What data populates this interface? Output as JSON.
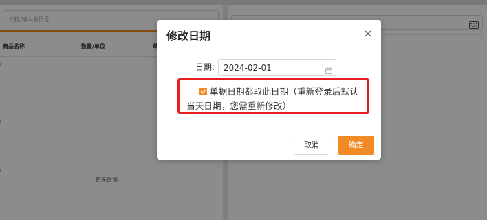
{
  "background": {
    "member_search": {
      "placeholder": "扫描/输入会员号"
    },
    "table": {
      "columns": [
        "商品名称",
        "数量/单位",
        "单"
      ],
      "empty_text": "暂无数据"
    },
    "scan_input": {
      "placeholder": ""
    },
    "accent_color": "#f08a24"
  },
  "dialog": {
    "title": "修改日期",
    "date_label": "日期:",
    "date_value": "2024-02-01",
    "option_text": "单据日期都取此日期（重新登录后默认当天日期，您需重新修改）",
    "option_checked": true,
    "cancel_label": "取消",
    "confirm_label": "确定",
    "highlight_color": "#e51f1f"
  }
}
